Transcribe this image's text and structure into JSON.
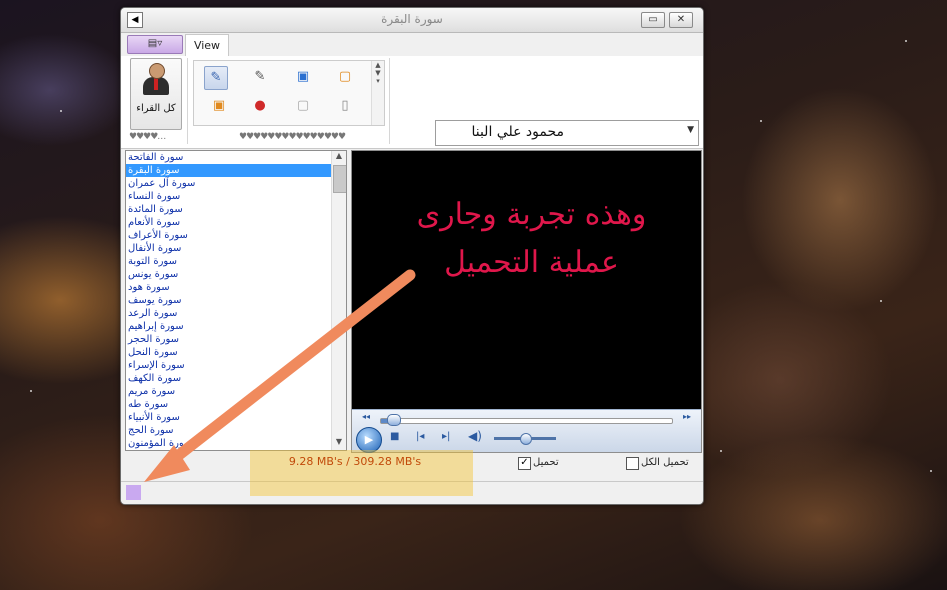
{
  "window": {
    "title": "سورة البقرة",
    "controls": {
      "minimize": "▭",
      "close": "✕"
    }
  },
  "ribbon": {
    "app_menu_label": "▤▿",
    "tab_view": "View",
    "reciters_button_label": "كل القراء",
    "group_label_reciters": "♥♥♥♥…",
    "group_label_gallery": "♥♥♥♥♥♥♥♥♥♥♥♥♥♥♥",
    "gallery_icons": [
      "edit-icon",
      "edit-gray-icon",
      "page-blue-icon",
      "page-orange-icon",
      "page-orange-icon",
      "stop-red-icon",
      "page-gray-icon",
      "page-white-icon"
    ]
  },
  "reciter_select": {
    "value": "محمود علي البنا"
  },
  "sura_list": {
    "selected_index": 1,
    "items": [
      "سورة الفاتحة",
      "سورة البقرة",
      "سورة آل عمران",
      "سورة النساء",
      "سورة المائدة",
      "سورة الأنعام",
      "سورة الأعراف",
      "سورة الأنفال",
      "سورة التوبة",
      "سورة يونس",
      "سورة هود",
      "سورة يوسف",
      "سورة الرعد",
      "سورة إبراهيم",
      "سورة الحجر",
      "سورة النحل",
      "سورة الإسراء",
      "سورة الكهف",
      "سورة مريم",
      "سورة طه",
      "سورة الأنبياء",
      "سورة الحج",
      "سورة المؤمنون"
    ]
  },
  "player": {
    "video_line1": "وهذه تجربة وجارى",
    "video_line2": "عملية التحميل",
    "seek_fraction": 0.03,
    "volume_fraction": 0.5
  },
  "download": {
    "progress_text": "9.28 MB's / 309.28 MB's",
    "download_label": "تحميل",
    "download_checked": true,
    "download_all_label": "تحميل الكل",
    "download_all_checked": false
  },
  "annotation": {
    "highlight_color": "#f4c430",
    "arrow_color": "#f08a5d"
  }
}
